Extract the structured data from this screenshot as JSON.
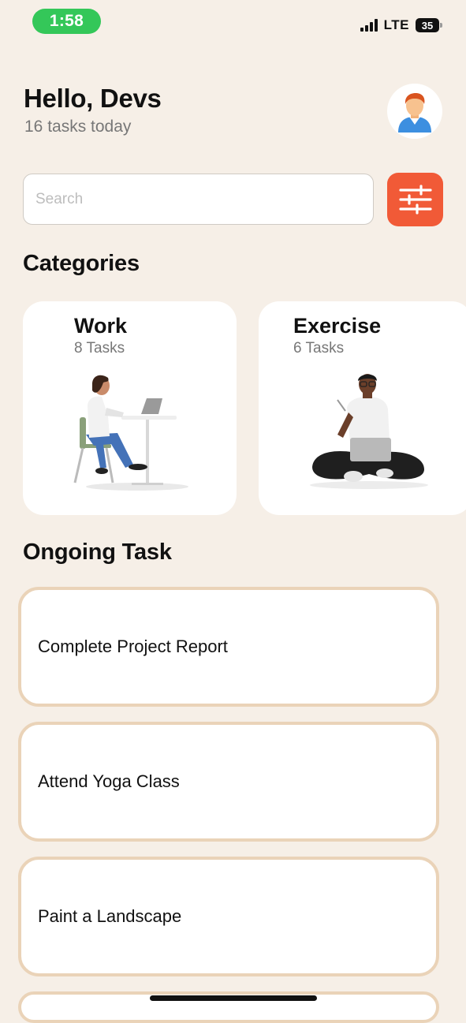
{
  "status_bar": {
    "time": "1:58",
    "network": "LTE",
    "battery": "35"
  },
  "header": {
    "greeting": "Hello, Devs",
    "subtitle": "16 tasks today",
    "avatar_icon": "person-avatar-icon"
  },
  "search": {
    "placeholder": "Search",
    "value": "",
    "filter_icon": "sliders-icon",
    "filter_color": "#f15a37"
  },
  "categories": {
    "title": "Categories",
    "items": [
      {
        "name": "Work",
        "count": "8 Tasks",
        "illustration": "person-at-desk-illustration"
      },
      {
        "name": "Exercise",
        "count": "6 Tasks",
        "illustration": "person-sitting-with-laptop-illustration"
      }
    ]
  },
  "ongoing": {
    "title": "Ongoing Task",
    "tasks": [
      {
        "label": "Complete Project Report"
      },
      {
        "label": "Attend Yoga Class"
      },
      {
        "label": "Paint a Landscape"
      }
    ]
  },
  "colors": {
    "background": "#f6efe7",
    "accent": "#f15a37",
    "task_border": "#ead3b8",
    "time_pill": "#34c759"
  }
}
